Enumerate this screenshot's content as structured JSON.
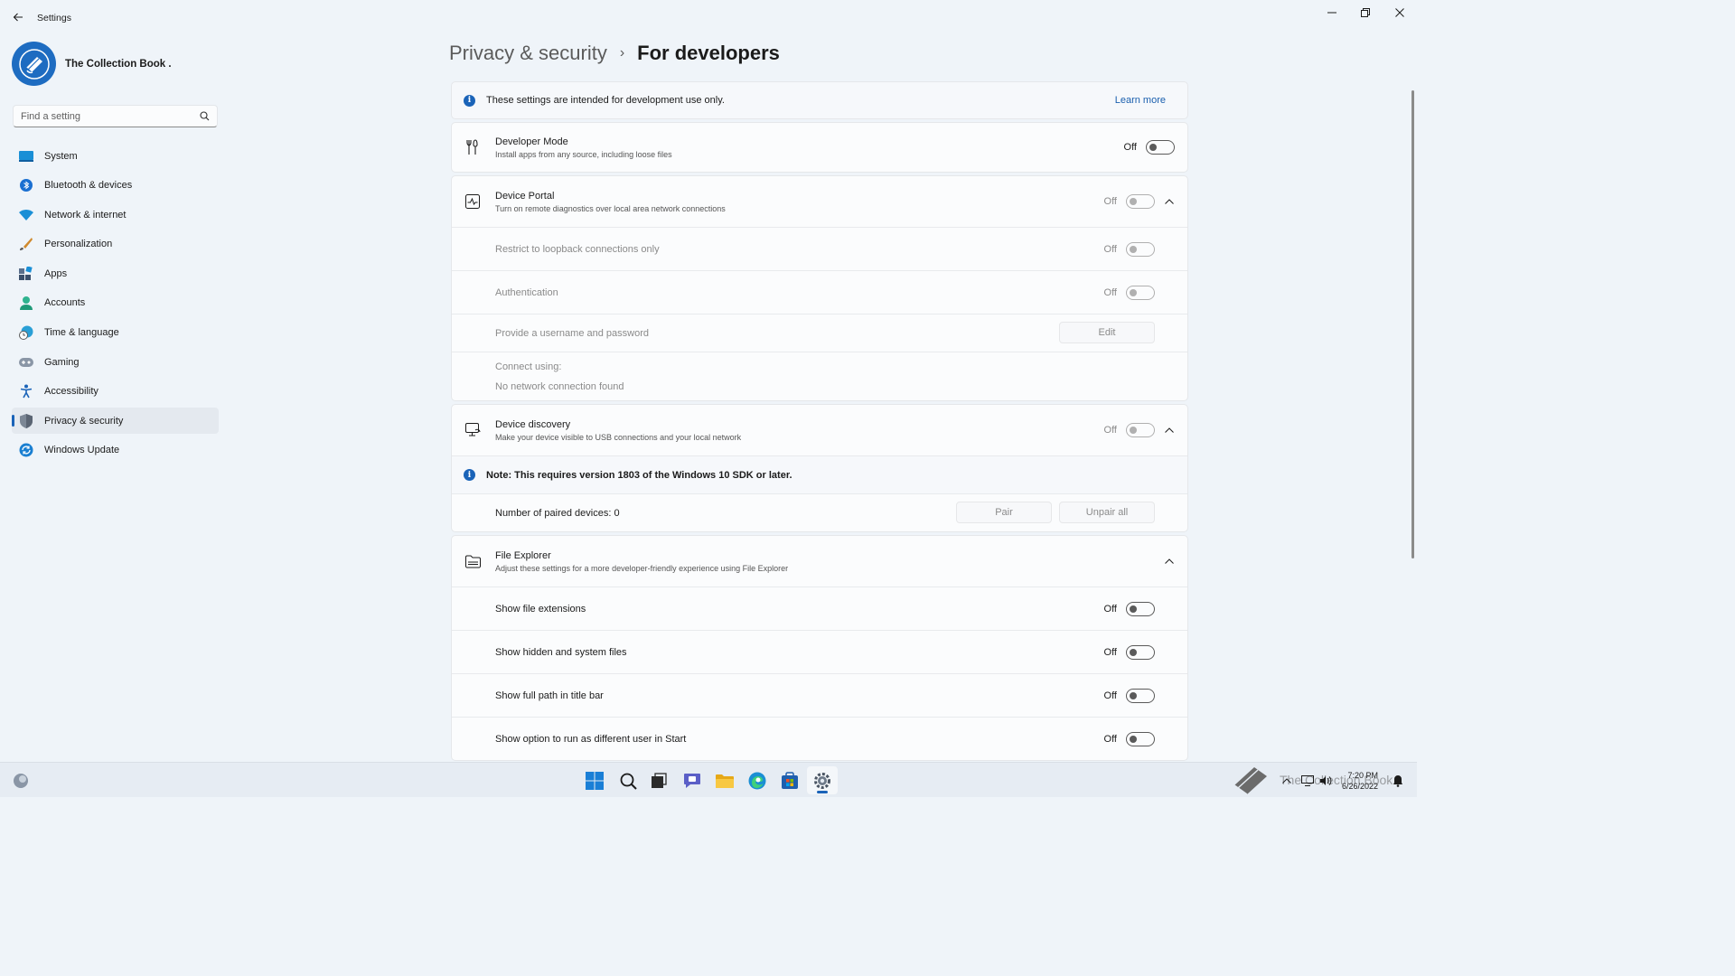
{
  "window": {
    "title": "Settings",
    "minimize": "–",
    "restore": "❐",
    "close": "✕"
  },
  "profile": {
    "name": "The Collection Book ."
  },
  "search": {
    "placeholder": "Find a setting"
  },
  "nav": [
    {
      "label": "System",
      "icon": "system-icon"
    },
    {
      "label": "Bluetooth & devices",
      "icon": "bluetooth-icon"
    },
    {
      "label": "Network & internet",
      "icon": "wifi-icon"
    },
    {
      "label": "Personalization",
      "icon": "brush-icon"
    },
    {
      "label": "Apps",
      "icon": "apps-icon"
    },
    {
      "label": "Accounts",
      "icon": "person-icon"
    },
    {
      "label": "Time & language",
      "icon": "globe-clock-icon"
    },
    {
      "label": "Gaming",
      "icon": "gamepad-icon"
    },
    {
      "label": "Accessibility",
      "icon": "accessibility-icon"
    },
    {
      "label": "Privacy & security",
      "icon": "shield-icon",
      "active": true
    },
    {
      "label": "Windows Update",
      "icon": "update-icon"
    }
  ],
  "breadcrumb": {
    "parent": "Privacy & security",
    "separator": "›",
    "current": "For developers"
  },
  "info": {
    "text": "These settings are intended for development use only.",
    "link": "Learn more"
  },
  "developer_mode": {
    "title": "Developer Mode",
    "subtitle": "Install apps from any source, including loose files",
    "state": "Off"
  },
  "device_portal": {
    "title": "Device Portal",
    "subtitle": "Turn on remote diagnostics over local area network connections",
    "state": "Off",
    "loopback": {
      "title": "Restrict to loopback connections only",
      "state": "Off"
    },
    "auth": {
      "title": "Authentication",
      "state": "Off"
    },
    "credentials": {
      "title": "Provide a username and password",
      "button": "Edit"
    },
    "connect_label": "Connect using:",
    "connect_value": "No network connection found"
  },
  "device_discovery": {
    "title": "Device discovery",
    "subtitle": "Make your device visible to USB connections and your local network",
    "state": "Off",
    "note": "Note: This requires version 1803 of the Windows 10 SDK or later.",
    "paired": "Number of paired devices: 0",
    "pair_button": "Pair",
    "unpair_button": "Unpair all"
  },
  "file_explorer": {
    "title": "File Explorer",
    "subtitle": "Adjust these settings for a more developer-friendly experience using File Explorer",
    "options": [
      {
        "title": "Show file extensions",
        "state": "Off"
      },
      {
        "title": "Show hidden and system files",
        "state": "Off"
      },
      {
        "title": "Show full path in title bar",
        "state": "Off"
      },
      {
        "title": "Show option to run as different user in Start",
        "state": "Off"
      }
    ]
  },
  "taskbar": {
    "time": "7:20 PM",
    "date": "6/26/2022",
    "watermark": "The Collection Book"
  },
  "colors": {
    "accent": "#1a63b8",
    "background": "#eff4f9",
    "card": "#fbfcfd"
  }
}
